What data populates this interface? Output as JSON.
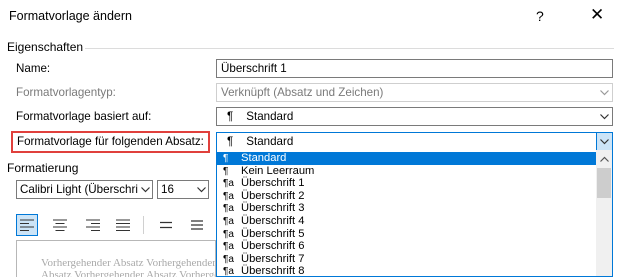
{
  "window": {
    "title": "Formatvorlage ändern",
    "help": "?",
    "close": "✕"
  },
  "properties": {
    "heading": "Eigenschaften",
    "name_label": "Name:",
    "name_value": "Überschrift 1",
    "type_label": "Formatvorlagentyp:",
    "type_value": "Verknüpft (Absatz und Zeichen)",
    "based_label": "Formatvorlage basiert auf:",
    "based_value": "Standard",
    "next_label": "Formatvorlage für folgenden Absatz:",
    "next_value": "Standard",
    "pilcrow": "¶"
  },
  "dropdown": {
    "items": [
      {
        "label": "Standard",
        "icon": "¶",
        "selected": true
      },
      {
        "label": "Kein Leerraum",
        "icon": "¶",
        "selected": false
      },
      {
        "label": "Überschrift 1",
        "icon": "¶a",
        "selected": false
      },
      {
        "label": "Überschrift 2",
        "icon": "¶a",
        "selected": false
      },
      {
        "label": "Überschrift 3",
        "icon": "¶a",
        "selected": false
      },
      {
        "label": "Überschrift 4",
        "icon": "¶a",
        "selected": false
      },
      {
        "label": "Überschrift 5",
        "icon": "¶a",
        "selected": false
      },
      {
        "label": "Überschrift 6",
        "icon": "¶a",
        "selected": false
      },
      {
        "label": "Überschrift 7",
        "icon": "¶a",
        "selected": false
      },
      {
        "label": "Überschrift 8",
        "icon": "¶a",
        "selected": false
      }
    ]
  },
  "formatting": {
    "heading": "Formatierung",
    "font": "Calibri Light (Überschriften)",
    "size": "16"
  },
  "preview": {
    "line1": "Vorhergehender Absatz Vorhergehender Absatz",
    "line2": "Absatz Vorhergehender Absatz Vorhergehender"
  },
  "colors": {
    "accent": "#0078d7",
    "highlight_border": "#e0403c",
    "selection_bg": "#cce4f7"
  }
}
